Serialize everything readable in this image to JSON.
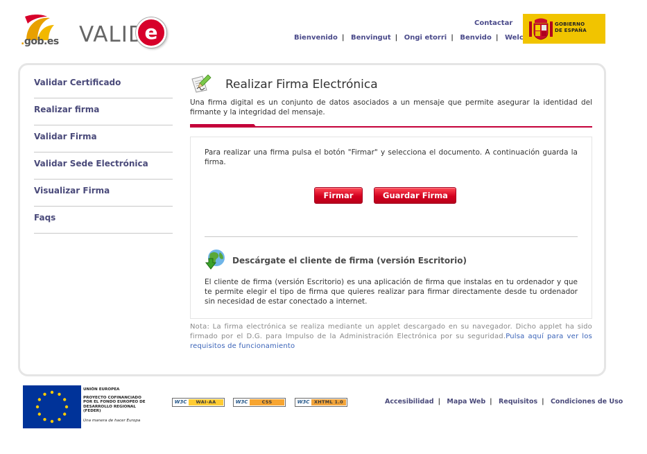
{
  "header": {
    "gob_logo_text": "gob",
    "gob_logo_suffix": ".es",
    "valide_logo_text": "VALID",
    "valide_logo_e": "e",
    "contact_label": "Contactar",
    "languages": [
      "Bienvenido",
      "Benvingut",
      "Ongi etorri",
      "Benvido",
      "Welcome"
    ],
    "gov_logo_line1": "GOBIERNO",
    "gov_logo_line2": "DE ESPAÑA"
  },
  "sidebar": {
    "items": [
      {
        "label": "Validar Certificado"
      },
      {
        "label": "Realizar firma"
      },
      {
        "label": "Validar Firma"
      },
      {
        "label": "Validar Sede Electrónica"
      },
      {
        "label": "Visualizar Firma"
      },
      {
        "label": "Faqs"
      }
    ]
  },
  "main": {
    "title": "Realizar Firma Electrónica",
    "intro": "Una firma digital es un conjunto de datos asociados a un mensaje que permite asegurar la identidad del firmante y la integridad del mensaje.",
    "instructions": "Para realizar una firma pulsa el botón \"Firmar\" y selecciona el documento. A continuación guarda la firma.",
    "sign_button": "Firmar",
    "save_button": "Guardar Firma",
    "download_title": "Descárgate el cliente de firma (versión Escritorio)",
    "download_desc": "El cliente de firma (versión Escritorio) es una aplicación de firma que instalas en tu ordenador y que te permite elegir el tipo de firma que quieres realizar para firmar directamente desde tu ordenador sin necesidad de estar conectado a internet.",
    "note_text": "Nota: La firma electrónica se realiza mediante un applet descargado en su navegador. Dicho applet ha sido firmado por el D.G. para Impulso de la Administración Electrónica por su seguridad.",
    "note_link": "Pulsa aquí para ver los requisitos de funcionamiento"
  },
  "footer": {
    "eu_line1": "UNIÓN EUROPEA",
    "eu_line2": "PROYECTO COFINANCIADO",
    "eu_line3": "POR EL FONDO EUROPEO DE",
    "eu_line4": "DESARROLLO REGIONAL",
    "eu_line5": "(FEDER)",
    "eu_slogan": "Una manera de hacer Europa",
    "badges": [
      {
        "w3": "W3C",
        "label": "WAI-AA"
      },
      {
        "w3": "W3C",
        "label": "CSS"
      },
      {
        "w3": "W3C",
        "label": "XHTML 1.0"
      }
    ],
    "links": [
      "Accesibilidad",
      "Mapa Web",
      "Requisitos",
      "Condiciones de Uso"
    ]
  },
  "colors": {
    "accent_red": "#c4003a",
    "link_blue": "#4a4a7a",
    "gov_yellow": "#f1c400",
    "eu_blue": "#003399"
  }
}
